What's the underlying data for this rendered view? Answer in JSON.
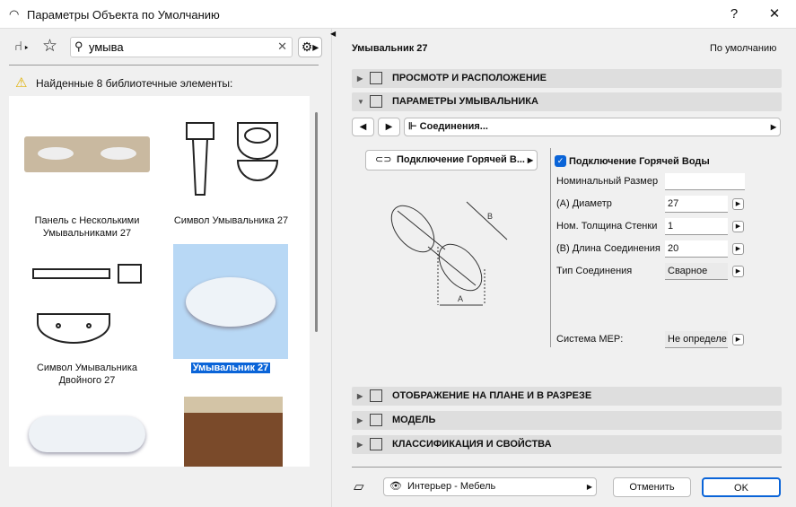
{
  "window": {
    "title": "Параметры Объекта по Умолчанию",
    "help": "?",
    "close": "✕"
  },
  "library": {
    "search_value": "умыва",
    "status": "Найденные 8 библиотечные элементы:",
    "items": [
      {
        "label": "Панель с Несколькими Умывальниками 27",
        "selected": false
      },
      {
        "label": "Символ Умывальника 27",
        "selected": false
      },
      {
        "label": "Символ Умывальника Двойного 27",
        "selected": false
      },
      {
        "label": "Умывальник 27",
        "selected": true
      },
      {
        "label": "",
        "selected": false
      },
      {
        "label": "",
        "selected": false
      }
    ]
  },
  "object": {
    "name": "Умывальник 27",
    "default_label": "По умолчанию"
  },
  "sections": {
    "view": "ПРОСМОТР И РАСПОЛОЖЕНИЕ",
    "params": "ПАРАМЕТРЫ УМЫВАЛЬНИКА",
    "plan": "ОТОБРАЖЕНИЕ НА ПЛАНЕ И В РАЗРЕЗЕ",
    "model": "МОДЕЛЬ",
    "classification": "КЛАССИФИКАЦИЯ И СВОЙСТВА"
  },
  "params": {
    "page": "Соединения...",
    "connection_select": "Подключение Горячей В...",
    "checkbox_label": "Подключение Горячей Воды",
    "checkbox_checked": true,
    "diagram_labels": {
      "a": "A",
      "b": "B"
    },
    "fields": [
      {
        "label": "Номинальный Размер",
        "value": ""
      },
      {
        "label": "(A) Диаметр",
        "value": "27"
      },
      {
        "label": "Ном. Толщина Стенки",
        "value": "1"
      },
      {
        "label": "(B) Длина Соединения",
        "value": "20"
      },
      {
        "label": "Тип Соединения",
        "value": "Сварное"
      }
    ],
    "mep_label": "Система MEP:",
    "mep_value": "Не определе"
  },
  "footer": {
    "layer": "Интерьер - Мебель",
    "cancel": "Отменить",
    "ok": "OK"
  },
  "colors": {
    "accent": "#0a64d8",
    "selection_bg": "#b8d8f5"
  }
}
